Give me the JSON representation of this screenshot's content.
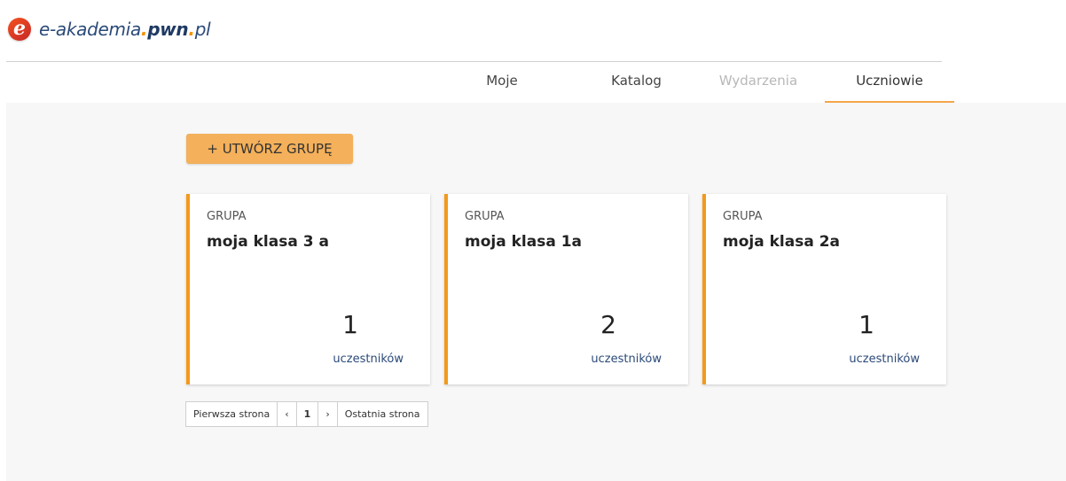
{
  "brand": {
    "mark": "e",
    "name_prefix": "e-akademia",
    "name_sep1": ".",
    "name_brand": "pwn",
    "name_sep2": ".",
    "name_suffix": "pl",
    "accent_color": "#f39200"
  },
  "nav": {
    "tabs": [
      {
        "label": "Moje",
        "state": "normal"
      },
      {
        "label": "Katalog",
        "state": "normal"
      },
      {
        "label": "Wydarzenia",
        "state": "disabled"
      },
      {
        "label": "Uczniowie",
        "state": "active"
      }
    ]
  },
  "toolbar": {
    "create_label": "+ UTWÓRZ GRUPĘ",
    "button_color": "#f4b05a"
  },
  "groups": [
    {
      "kind": "GRUPA",
      "name": "moja klasa 3 a",
      "count": "1",
      "unit": "uczestników"
    },
    {
      "kind": "GRUPA",
      "name": "moja klasa 1a",
      "count": "2",
      "unit": "uczestników"
    },
    {
      "kind": "GRUPA",
      "name": "moja klasa 2a",
      "count": "1",
      "unit": "uczestników"
    }
  ],
  "pagination": {
    "first": "Pierwsza strona",
    "prev": "‹",
    "current": "1",
    "next": "›",
    "last": "Ostatnia strona"
  },
  "colors": {
    "card_accent": "#f39a1b",
    "active_tab_underline": "#f4a64b",
    "link_text": "#2b4a78"
  }
}
